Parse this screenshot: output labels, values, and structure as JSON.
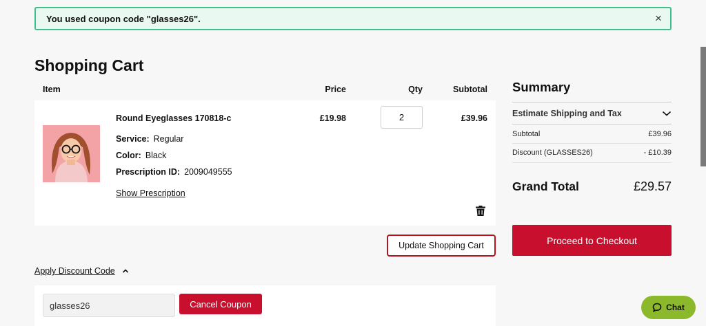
{
  "notice": {
    "message": "You used coupon code \"glasses26\".",
    "close_glyph": "×"
  },
  "cart": {
    "title": "Shopping Cart",
    "columns": {
      "item": "Item",
      "price": "Price",
      "qty": "Qty",
      "subtotal": "Subtotal"
    },
    "items": [
      {
        "name": "Round Eyeglasses 170818-c",
        "options": [
          {
            "label": "Service:",
            "value": "Regular"
          },
          {
            "label": "Color:",
            "value": "Black"
          },
          {
            "label": "Prescription ID:",
            "value": "2009049555"
          }
        ],
        "show_prescription": "Show Prescription",
        "price": "£19.98",
        "qty": "2",
        "subtotal": "£39.96"
      }
    ],
    "update_label": "Update Shopping Cart"
  },
  "discount": {
    "toggle_label": "Apply Discount Code",
    "code_value": "glasses26",
    "cancel_label": "Cancel Coupon"
  },
  "summary": {
    "title": "Summary",
    "estimate_label": "Estimate Shipping and Tax",
    "subtotal_label": "Subtotal",
    "subtotal_value": "£39.96",
    "discount_label": "Discount (GLASSES26)",
    "discount_value": "- £10.39",
    "grand_label": "Grand Total",
    "grand_value": "£29.57",
    "checkout_label": "Proceed to Checkout"
  },
  "chat": {
    "label": "Chat"
  },
  "colors": {
    "brand_red": "#c8102e",
    "success_green": "#3fbf8c",
    "chat_green": "#8cb82b"
  },
  "icons": {
    "close": "close-icon",
    "trash": "trash-icon",
    "chevron_up": "chevron-up-icon",
    "chevron_down": "chevron-down-icon",
    "chat": "chat-bubble-icon"
  }
}
